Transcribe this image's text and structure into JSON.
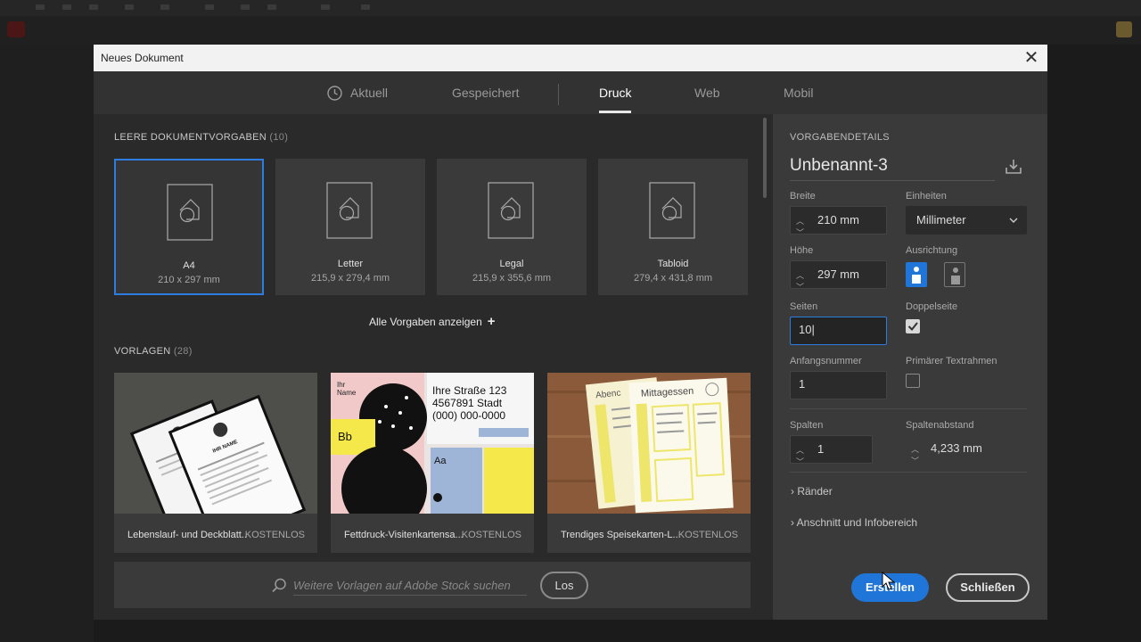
{
  "dialog": {
    "title": "Neues Dokument",
    "close_icon": "close-icon"
  },
  "tabs": [
    {
      "label": "Aktuell",
      "icon": "clock-icon",
      "active": false
    },
    {
      "label": "Gespeichert",
      "active": false
    },
    {
      "label": "Druck",
      "active": true
    },
    {
      "label": "Web",
      "active": false
    },
    {
      "label": "Mobil",
      "active": false
    }
  ],
  "presets": {
    "heading": "LEERE DOKUMENTVORGABEN",
    "count": "(10)",
    "items": [
      {
        "name": "A4",
        "size": "210 x 297 mm",
        "selected": true
      },
      {
        "name": "Letter",
        "size": "215,9 x 279,4 mm",
        "selected": false
      },
      {
        "name": "Legal",
        "size": "215,9 x 355,6 mm",
        "selected": false
      },
      {
        "name": "Tabloid",
        "size": "279,4 x 431,8 mm",
        "selected": false
      }
    ],
    "show_all": "Alle Vorgaben anzeigen"
  },
  "templates": {
    "heading": "VORLAGEN",
    "count": "(28)",
    "items": [
      {
        "name": "Lebenslauf- und Deckblatt..",
        "badge": "KOSTENLOS",
        "thumb_text": "IHR NAME"
      },
      {
        "name": "Fettdruck-Visitenkartensa...",
        "badge": "KOSTENLOS",
        "thumb_text": {
          "ihr": "Ihr",
          "name": "Name",
          "line1": "Ihre Straße 123",
          "line2": "4567891 Stadt",
          "line3": "(000) 000-0000",
          "bb": "Bb",
          "aa": "Aa"
        }
      },
      {
        "name": "Trendiges Speisekarten-L...",
        "badge": "KOSTENLOS",
        "thumb_text": {
          "left": "Abenc",
          "right": "Mittagessen"
        }
      }
    ]
  },
  "search": {
    "placeholder": "Weitere Vorlagen auf Adobe Stock suchen",
    "button": "Los"
  },
  "details": {
    "heading": "VORGABENDETAILS",
    "preset_name": "Unbenannt-3",
    "width_label": "Breite",
    "width_value": "210 mm",
    "units_label": "Einheiten",
    "units_value": "Millimeter",
    "height_label": "Höhe",
    "height_value": "297 mm",
    "orientation_label": "Ausrichtung",
    "orientation_value": "portrait",
    "pages_label": "Seiten",
    "pages_value": "10",
    "facing_label": "Doppelseite",
    "facing_checked": true,
    "start_label": "Anfangsnummer",
    "start_value": "1",
    "primary_frame_label": "Primärer Textrahmen",
    "primary_frame_checked": false,
    "columns_label": "Spalten",
    "columns_value": "1",
    "gutter_label": "Spaltenabstand",
    "gutter_value": "4,233 mm",
    "margins_label": "Ränder",
    "bleed_label": "Anschnitt und Infobereich"
  },
  "actions": {
    "create": "Erstellen",
    "close": "Schließen"
  },
  "colors": {
    "accent": "#1f76d8",
    "dialog_bg": "#323232",
    "panel_bg": "#3a3a3a"
  }
}
